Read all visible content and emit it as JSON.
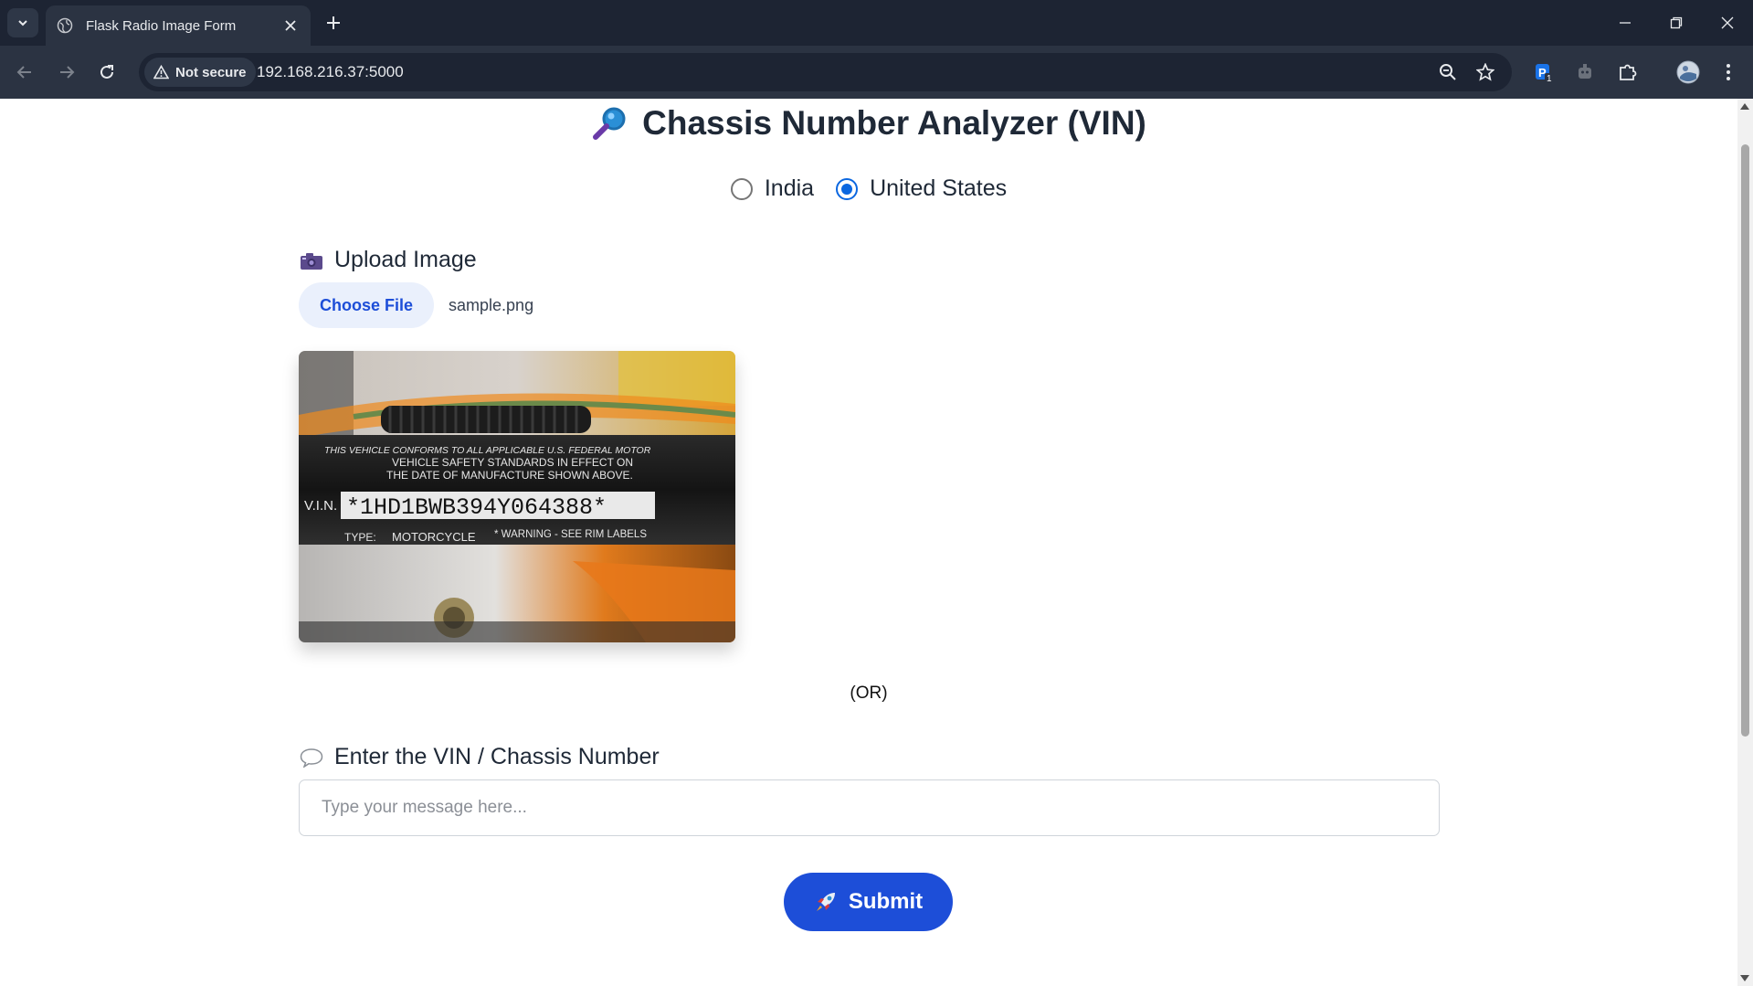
{
  "browser": {
    "tab_title": "Flask Radio Image Form",
    "security_label": "Not secure",
    "url": "192.168.216.37:5000",
    "extension_badge": "1"
  },
  "page": {
    "title": "Chassis Number Analyzer (VIN)",
    "title_icon": "magnifying-glass",
    "country_options": [
      {
        "label": "India",
        "checked": false
      },
      {
        "label": "United States",
        "checked": true
      }
    ],
    "upload": {
      "label": "Upload Image",
      "icon": "camera",
      "choose_button": "Choose File",
      "file_name": "sample.png"
    },
    "preview_image": {
      "line1": "THIS VEHICLE CONFORMS TO ALL APPLICABLE U.S. FEDERAL MOTOR",
      "line2": "VEHICLE SAFETY STANDARDS IN EFFECT ON",
      "line3": "THE DATE OF MANUFACTURE SHOWN ABOVE.",
      "vin_label": "V.I.N.",
      "vin_value": "*1HD1BWB394Y064388*",
      "type_label": "TYPE:",
      "type_value": "MOTORCYCLE",
      "warning": "* WARNING - SEE RIM LABELS"
    },
    "or_text": "(OR)",
    "vin_input": {
      "label": "Enter the VIN / Chassis Number",
      "icon": "speech-bubble",
      "placeholder": "Type your message here...",
      "value": ""
    },
    "submit": {
      "label": "Submit",
      "icon": "rocket"
    }
  },
  "colors": {
    "primary": "#1d4ed8",
    "radio_checked": "#0b67e0",
    "chrome_dark": "#1d2433",
    "chrome_toolbar": "#2b3342"
  }
}
